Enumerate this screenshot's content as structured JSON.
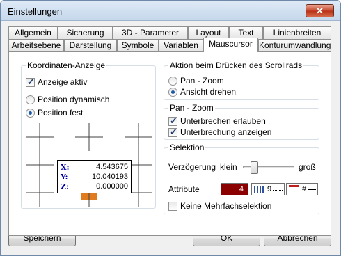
{
  "window": {
    "title": "Einstellungen",
    "close_label": "✕"
  },
  "tabs": {
    "row_back": [
      "Allgemein",
      "Sicherung",
      "3D - Parameter",
      "Layout",
      "Text",
      "Linienbreiten"
    ],
    "row_front": [
      "Arbeitsebene",
      "Darstellung",
      "Symbole",
      "Variablen",
      "Mauscursor",
      "Konturumwandlung"
    ],
    "active": "Mauscursor"
  },
  "koordinaten": {
    "group_label": "Koordinaten-Anzeige",
    "anzeige_aktiv": {
      "label": "Anzeige aktiv",
      "checked": true
    },
    "pos_dynamisch": {
      "label": "Position dynamisch",
      "selected": false
    },
    "pos_fest": {
      "label": "Position fest",
      "selected": true
    },
    "preview": {
      "x_label": "X:",
      "x_value": "4.543675",
      "y_label": "Y:",
      "y_value": "10.040193",
      "z_label": "Z:",
      "z_value": "0.000000"
    }
  },
  "scrollrad": {
    "group_label": "Aktion beim Drücken des Scrollrads",
    "pan_zoom": {
      "label": "Pan - Zoom",
      "selected": false
    },
    "ansicht_drehen": {
      "label": "Ansicht drehen",
      "selected": true
    }
  },
  "panzoom": {
    "group_label": "Pan - Zoom",
    "unterbrechen": {
      "label": "Unterbrechen erlauben",
      "checked": true
    },
    "unterbrechung_anzeigen": {
      "label": "Unterbrechung anzeigen",
      "checked": true
    }
  },
  "selektion": {
    "group_label": "Selektion",
    "verzoegerung_label": "Verzögerung",
    "klein_label": "klein",
    "gross_label": "groß",
    "slider_level": 0.2,
    "attribute_label": "Attribute",
    "color_value": "4",
    "linetype_value": "9",
    "linewidth_value": "#",
    "keine_mehrfach": {
      "label": "Keine Mehrfachselektion",
      "checked": false
    }
  },
  "buttons": {
    "save": "Speichern",
    "ok": "OK",
    "cancel": "Abbrechen"
  },
  "colors": {
    "attribute_color": "#8b0000",
    "cursor_marker": "#e07b20",
    "coord_label": "#0000a8"
  }
}
